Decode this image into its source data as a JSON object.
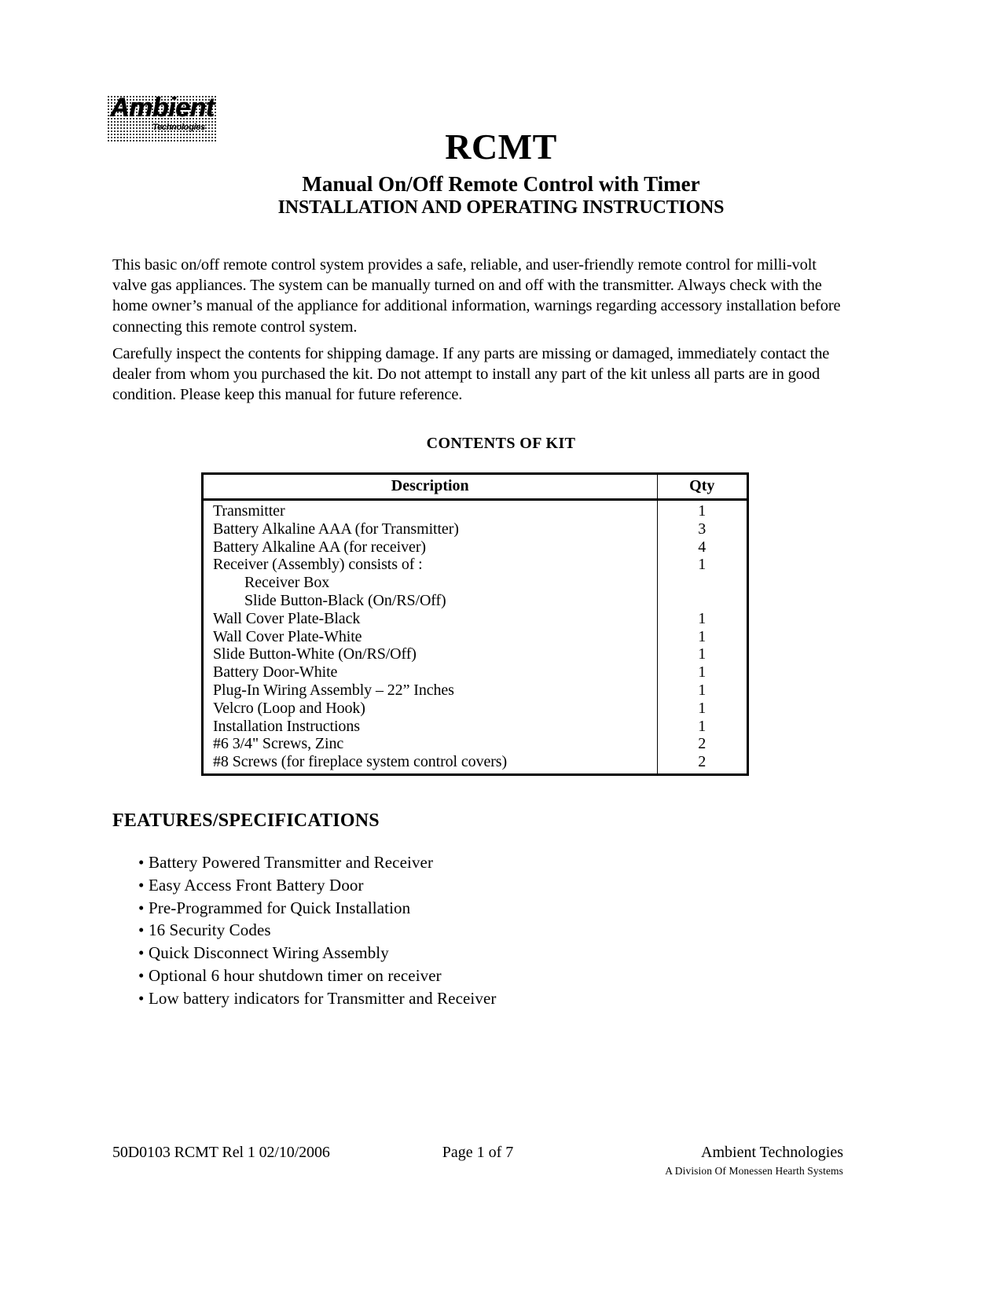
{
  "logo": {
    "word": "Ambient",
    "subtitle": "Technologies"
  },
  "header": {
    "title": "RCMT",
    "subtitle": "Manual On/Off Remote Control with Timer",
    "subtitle2": "INSTALLATION AND OPERATING INSTRUCTIONS"
  },
  "intro": {
    "paragraph1": "This basic on/off remote control system provides a safe, reliable, and user-friendly remote control for milli-volt valve gas appliances. The system can be manually turned on and off with the transmitter. Always check with the home owner’s manual of the appliance for additional information, warnings regarding accessory installation before connecting this remote control system.",
    "paragraph2": "Carefully inspect the contents for shipping damage. If any parts are missing or damaged, immediately contact the dealer from whom you purchased the kit. Do not attempt to install any part of the kit unless all parts are in good condition. Please keep this manual for future reference."
  },
  "contents": {
    "heading": "CONTENTS OF KIT",
    "columns": [
      "Description",
      "Qty"
    ],
    "rows": [
      {
        "description": "Transmitter",
        "qty": "1",
        "indent": 0
      },
      {
        "description": "Battery Alkaline AAA (for Transmitter)",
        "qty": "3",
        "indent": 0
      },
      {
        "description": "Battery Alkaline AA (for receiver)",
        "qty": "4",
        "indent": 0
      },
      {
        "description": "Receiver (Assembly)  consists of :",
        "qty": "1",
        "indent": 0
      },
      {
        "description": "Receiver Box",
        "qty": "",
        "indent": 1
      },
      {
        "description": "Slide Button-Black (On/RS/Off)",
        "qty": "",
        "indent": 1
      },
      {
        "description": "Wall Cover Plate-Black",
        "qty": "1",
        "indent": 0
      },
      {
        "description": "Wall Cover Plate-White",
        "qty": "1",
        "indent": 0
      },
      {
        "description": "Slide Button-White (On/RS/Off)",
        "qty": "1",
        "indent": 0
      },
      {
        "description": "Battery Door-White",
        "qty": "1",
        "indent": 0
      },
      {
        "description": "Plug-In Wiring Assembly – 22” Inches",
        "qty": "1",
        "indent": 0
      },
      {
        "description": "Velcro (Loop and Hook)",
        "qty": "1",
        "indent": 0
      },
      {
        "description": "Installation Instructions",
        "qty": "1",
        "indent": 0
      },
      {
        "description": "#6 3/4\"  Screws, Zinc",
        "qty": "2",
        "indent": 0
      },
      {
        "description": "#8 Screws  (for fireplace system control covers)",
        "qty": "2",
        "indent": 0
      }
    ]
  },
  "features": {
    "heading": "FEATURES/SPECIFICATIONS",
    "bullet_glyph": "•",
    "items": [
      "Battery Powered Transmitter and Receiver",
      "Easy Access Front Battery Door",
      "Pre-Programmed for Quick Installation",
      "16 Security Codes",
      "Quick Disconnect Wiring Assembly",
      "Optional 6 hour shutdown timer on receiver",
      "Low battery indicators for Transmitter and Receiver"
    ]
  },
  "footer": {
    "left": "50D0103 RCMT Rel 1  02/10/2006",
    "center": "Page 1 of 7",
    "right": "Ambient Technologies",
    "right_sub": "A Division Of  Monessen Hearth Systems"
  }
}
